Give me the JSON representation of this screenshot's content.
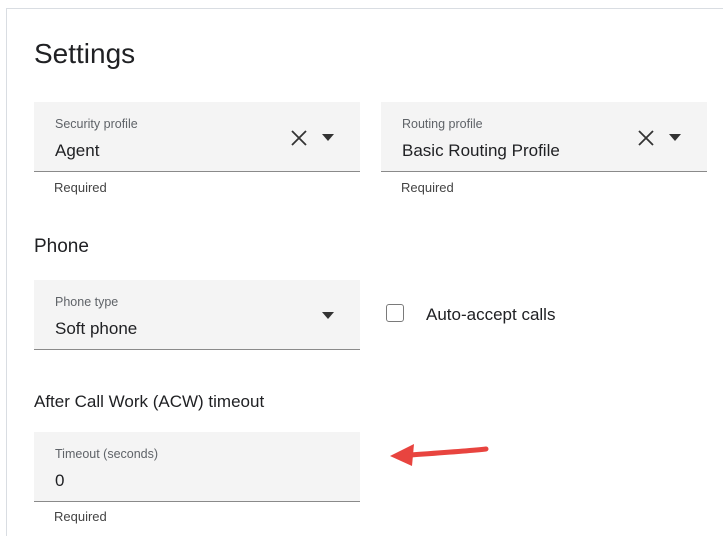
{
  "settings": {
    "title": "Settings",
    "security_profile": {
      "label": "Security profile",
      "value": "Agent",
      "helper": "Required"
    },
    "routing_profile": {
      "label": "Routing profile",
      "value": "Basic Routing Profile",
      "helper": "Required"
    },
    "phone": {
      "heading": "Phone",
      "phone_type": {
        "label": "Phone type",
        "value": "Soft phone"
      },
      "auto_accept": {
        "label": "Auto-accept calls",
        "checked": false
      }
    },
    "acw": {
      "heading": "After Call Work (ACW) timeout",
      "timeout": {
        "label": "Timeout (seconds)",
        "value": "0",
        "helper": "Required"
      }
    }
  },
  "colors": {
    "field_bg": "#f4f4f4",
    "annotation_arrow": "#e8443f"
  },
  "icons": {
    "clear": "close-icon",
    "dropdown": "caret-down-icon",
    "annotation": "arrow-left-icon"
  }
}
